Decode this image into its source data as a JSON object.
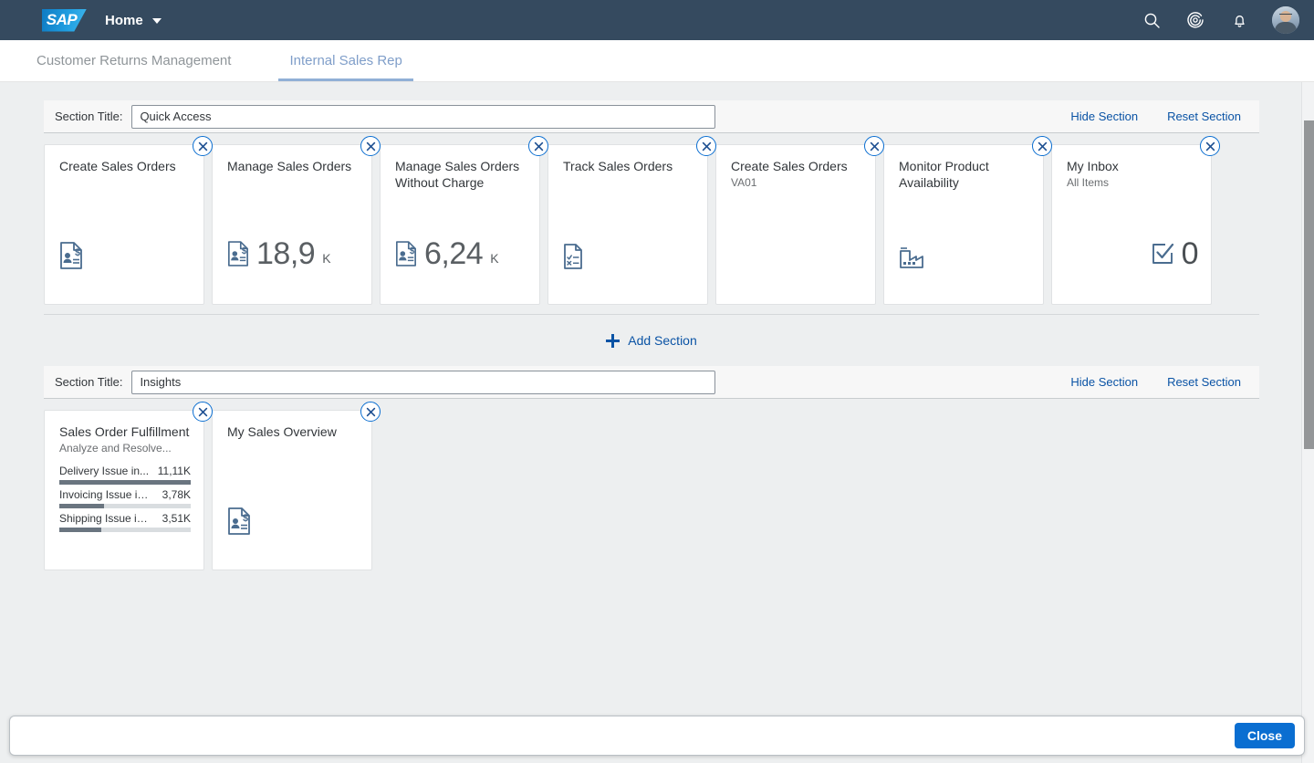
{
  "header": {
    "logo_text": "SAP",
    "home_label": "Home",
    "icons": {
      "search": "search-icon",
      "copilot": "copilot-icon",
      "notifications": "bell-icon",
      "avatar": "user-avatar"
    }
  },
  "tabs": [
    {
      "label": "Customer Returns Management",
      "selected": false
    },
    {
      "label": "Internal Sales Rep",
      "selected": true
    }
  ],
  "sections": [
    {
      "title_label": "Section Title:",
      "title_value": "Quick Access",
      "hide_label": "Hide Section",
      "reset_label": "Reset Section",
      "tiles": [
        {
          "title": "Create Sales Orders",
          "subtitle": "",
          "icon": "sales-order-document-icon",
          "value": "",
          "unit": "",
          "layout": "icon-left"
        },
        {
          "title": "Manage Sales Orders",
          "subtitle": "",
          "icon": "sales-order-document-icon",
          "value": "18,9",
          "unit": "K",
          "layout": "kpi"
        },
        {
          "title": "Manage Sales Orders Without Charge",
          "subtitle": "",
          "icon": "sales-order-document-icon",
          "value": "6,24",
          "unit": "K",
          "layout": "kpi"
        },
        {
          "title": "Track Sales Orders",
          "subtitle": "",
          "icon": "task-list-document-icon",
          "value": "",
          "unit": "",
          "layout": "icon-left"
        },
        {
          "title": "Create Sales Orders",
          "subtitle": "VA01",
          "icon": "",
          "value": "",
          "unit": "",
          "layout": "none"
        },
        {
          "title": "Monitor Product Availability",
          "subtitle": "",
          "icon": "factory-icon",
          "value": "",
          "unit": "",
          "layout": "icon-left"
        },
        {
          "title": "My Inbox",
          "subtitle": "All Items",
          "icon": "approval-checkbox-icon",
          "value": "0",
          "unit": "",
          "layout": "kpi-right"
        }
      ]
    },
    {
      "title_label": "Section Title:",
      "title_value": "Insights",
      "hide_label": "Hide Section",
      "reset_label": "Reset Section",
      "tiles": [
        {
          "title": "Sales Order Fulfillment",
          "subtitle": "Analyze and Resolve...",
          "icon": "",
          "value": "",
          "unit": "",
          "layout": "bars"
        },
        {
          "title": "My Sales Overview",
          "subtitle": "",
          "icon": "sales-order-document-icon",
          "value": "",
          "unit": "",
          "layout": "icon-left"
        }
      ]
    }
  ],
  "bar_list": {
    "rows": [
      {
        "label": "Delivery Issue in...",
        "value": "11,11K",
        "pct": 100
      },
      {
        "label": "Invoicing Issue in...",
        "value": "3,78K",
        "pct": 34
      },
      {
        "label": "Shipping Issue in...",
        "value": "3,51K",
        "pct": 32
      }
    ]
  },
  "add_section": {
    "label": "Add Section"
  },
  "footer": {
    "close_label": "Close"
  },
  "colors": {
    "shell_header": "#354a5f",
    "accent_blue": "#0a6ed1",
    "link_blue": "#0a53a5",
    "tile_icon_blue": "#4a6c8f",
    "bar_fill": "#6a7580",
    "canvas": "#edeff0"
  },
  "tile_remove_icon": "close-circle-icon"
}
